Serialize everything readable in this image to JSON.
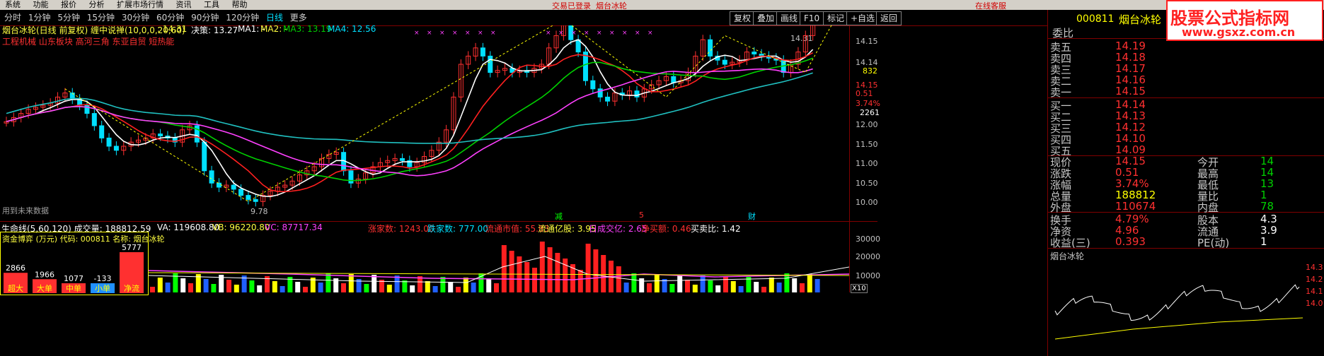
{
  "menu": {
    "items": [
      "系统",
      "功能",
      "报价",
      "分析",
      "扩展市场行情",
      "资讯",
      "工具",
      "帮助"
    ],
    "status_left": "交易已登录",
    "status_right": "烟台冰轮",
    "btn": "在线客服"
  },
  "periods": [
    "分时",
    "1分钟",
    "5分钟",
    "15分钟",
    "30分钟",
    "60分钟",
    "90分钟",
    "120分钟",
    "日线",
    "更多"
  ],
  "active_period": "日线",
  "toolbar_buttons": [
    "复权",
    "叠加",
    "画线",
    "F10",
    "标记",
    "+自选",
    "返回"
  ],
  "chart": {
    "indicator_line": "烟台冰轮(日线 前复权) 缠中说禅(10,0,0,20,60)",
    "val1": ": 14.31",
    "decision": "决策: 13.27",
    "ma1": "MA1: -",
    "ma2": "MA2: -",
    "ma3": "MA3: 13.19",
    "ma4": "MA4: 12.56",
    "concepts": "工程机械 山东板块 高河三角 东亚自贸 短热能",
    "high_label": "14.31",
    "low_label": "9.78",
    "future_note": "用到未来数据",
    "event_marks": [
      "减",
      "5",
      "财"
    ],
    "y_ticks": [
      "14.15",
      "14.14",
      "832",
      "14.15",
      "0.51",
      "3.74%",
      "2261",
      "12.00",
      "11.50",
      "11.00",
      "10.50",
      "10.00"
    ],
    "colors": {
      "up": "#ff3030",
      "down": "#00e0ff",
      "ma_white": "#ffffff",
      "ma_red": "#ff2020",
      "ma_green": "#00d000",
      "ma_magenta": "#ff40ff",
      "ma_cyan": "#20c0c0"
    }
  },
  "lower": {
    "title": "生命线(5,60,120) 成交量: 188812.59",
    "va": "VA: 119608.80",
    "vb": "VB: 96220.80",
    "vc": "VC: 87717.34",
    "rise_count": "涨家数: 1243.00",
    "fall_count": "跌家数: 777.00",
    "circ_val": "流通市值: 55.83",
    "circ_cap": "流通亿股: 3.95",
    "turnover": "日成交亿: 2.65",
    "net_buy": "净买额: 0.46",
    "buy_sell": "买卖比: 1.42",
    "y_ticks": [
      "30000",
      "20000",
      "10000"
    ],
    "x10": "X10"
  },
  "fundflow": {
    "header": "资金博弈 (万元)  代码: 000811 名称: 烟台冰轮",
    "bars": [
      {
        "value": "2866",
        "label": "超大",
        "color": "#ff3030"
      },
      {
        "value": "1966",
        "label": "大单",
        "color": "#ff3030"
      },
      {
        "value": "1077",
        "label": "中单",
        "color": "#ff3030"
      },
      {
        "value": "-133",
        "label": "小单",
        "color": "#2090ff"
      },
      {
        "value": "5777",
        "label": "净流",
        "color": "#ff3030"
      }
    ]
  },
  "right": {
    "code": "000811",
    "name": "烟台冰轮",
    "webbi": "委比",
    "asks": [
      {
        "label": "卖五",
        "price": "14.19"
      },
      {
        "label": "卖四",
        "price": "14.18"
      },
      {
        "label": "卖三",
        "price": "14.17"
      },
      {
        "label": "卖二",
        "price": "14.16"
      },
      {
        "label": "卖一",
        "price": "14.15"
      }
    ],
    "bids": [
      {
        "label": "买一",
        "price": "14.14"
      },
      {
        "label": "买二",
        "price": "14.13"
      },
      {
        "label": "买三",
        "price": "14.12"
      },
      {
        "label": "买四",
        "price": "14.10"
      },
      {
        "label": "买五",
        "price": "14.09"
      }
    ],
    "stats": [
      {
        "l": "现价",
        "v": "14.15",
        "vc": "red",
        "l2": "今开",
        "v2": "14"
      },
      {
        "l": "涨跌",
        "v": "0.51",
        "vc": "red",
        "l2": "最高",
        "v2": "14"
      },
      {
        "l": "涨幅",
        "v": "3.74%",
        "vc": "red",
        "l2": "最低",
        "v2": "13"
      },
      {
        "l": "总量",
        "v": "188812",
        "vc": "yellow",
        "l2": "量比",
        "v2": "1"
      },
      {
        "l": "外盘",
        "v": "110674",
        "vc": "red",
        "l2": "内盘",
        "v2": "78"
      }
    ],
    "stats2": [
      {
        "l": "换手",
        "v": "4.79%",
        "l2": "股本",
        "v2": "4.3"
      },
      {
        "l": "净资",
        "v": "4.96",
        "l2": "流通",
        "v2": "3.9"
      },
      {
        "l": "收益(三)",
        "v": "0.393",
        "l2": "PE(动)",
        "v2": "1"
      }
    ],
    "mini_title": "烟台冰轮",
    "mini_ticks": [
      "14.3",
      "14.2",
      "14.1",
      "14.0"
    ],
    "logo_top": "股票公式指标网",
    "logo_bottom": "www.gsxz.com.cn"
  }
}
